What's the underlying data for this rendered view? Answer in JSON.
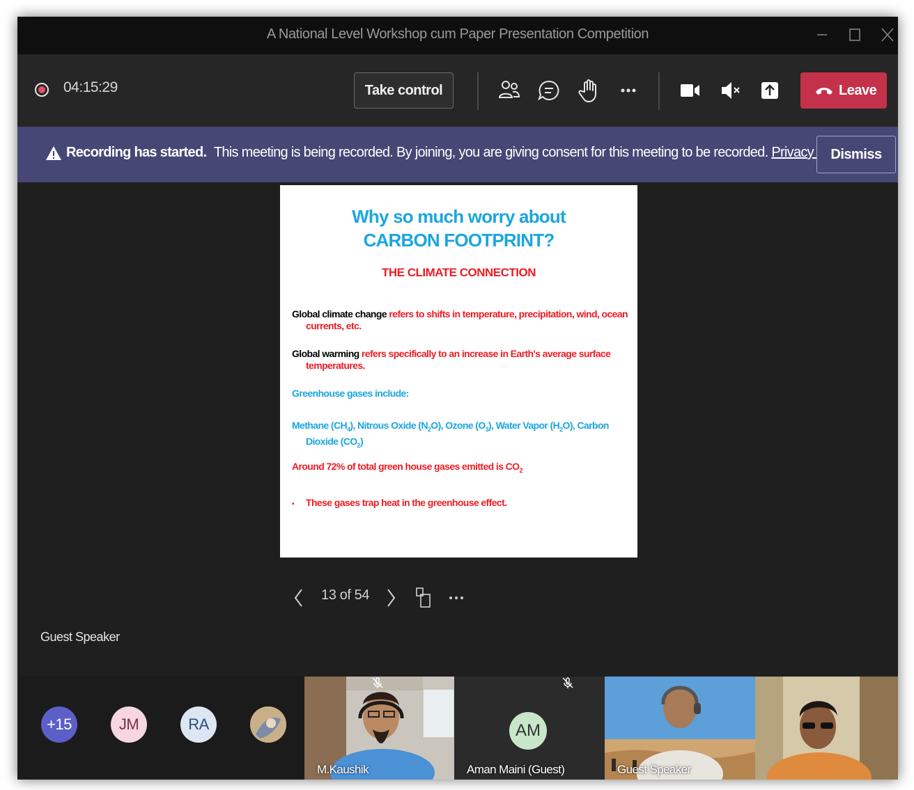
{
  "window": {
    "title": "A National Level Workshop cum Paper Presentation Competition"
  },
  "toolbar": {
    "timer": "04:15:29",
    "take_control_label": "Take control",
    "leave_label": "Leave",
    "icons": [
      "people-icon",
      "chat-icon",
      "raise-hand-icon",
      "more-icon",
      "camera-icon",
      "mic-muted-icon",
      "share-icon"
    ]
  },
  "banner": {
    "bold": "Recording has started.",
    "text": "This meeting is being recorded. By joining, you are giving consent for this meeting to be recorded.",
    "link": "Privacy policy",
    "dismiss_label": "Dismiss"
  },
  "slide": {
    "title_line1": "Why so much worry about",
    "title_line2": "CARBON FOOTPRINT?",
    "subtitle": "THE CLIMATE CONNECTION",
    "p1_term": "Global climate change",
    "p1_def_a": "refers to shifts in temperature, precipitation, wind, ocean",
    "p1_def_b": "currents, etc.",
    "p2_term": "Global warming",
    "p2_def_a": "refers specifically to an increase in Earth's average surface",
    "p2_def_b": "temperatures.",
    "p3": "Greenhouse gases include:",
    "gases": {
      "methane": "Methane (CH",
      "methane_sub": "4",
      "nitrous": "), Nitrous Oxide (N",
      "nitrous_sub": "2",
      "ozone": "O), Ozone (O",
      "ozone_sub": "3",
      "water": "), Water Vapor (H",
      "water_sub": "2",
      "carbon": "O), Carbon",
      "dioxide": "Dioxide (CO",
      "dioxide_sub": "2",
      "close": ")"
    },
    "p5": "Around 72% of total green house gases emitted is CO",
    "p5_sub": "2",
    "bullet_mark": "•",
    "bullet": "These gases trap heat in the greenhouse effect."
  },
  "slide_nav": {
    "page": "13 of 54"
  },
  "stage": {
    "speaker_label": "Guest Speaker"
  },
  "participants": {
    "overflow": "+15",
    "avatars": [
      {
        "initials": "JM",
        "bg": "#f6d6e0",
        "fg": "#7a3048"
      },
      {
        "initials": "RA",
        "bg": "#dde6f3",
        "fg": "#2e4e78"
      }
    ],
    "tiles": [
      {
        "name": "M.Kaushik"
      },
      {
        "name": "Aman Maini (Guest)",
        "initials": "AM"
      },
      {
        "name": "Guest Speaker"
      }
    ]
  },
  "colors": {
    "leave": "#c4314b",
    "banner": "#464775",
    "slide_title": "#1aa6df",
    "slide_red": "#ee1c24"
  }
}
